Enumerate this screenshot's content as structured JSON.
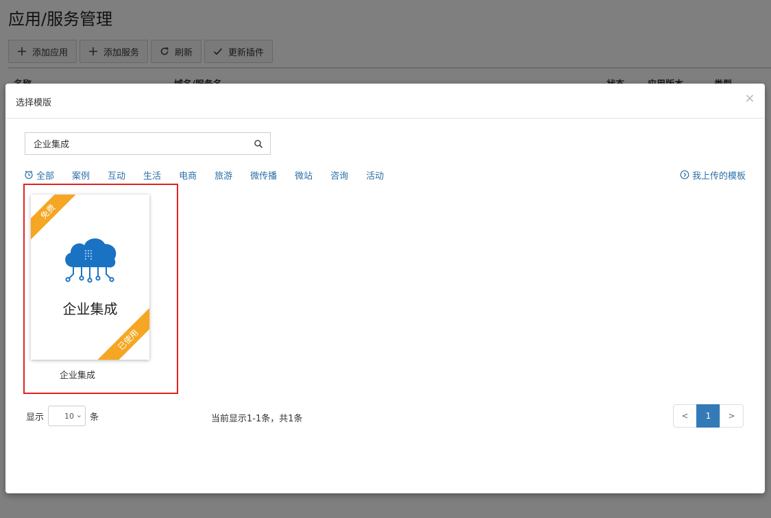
{
  "page": {
    "title": "应用/服务管理",
    "toolbar": [
      {
        "label": "添加应用",
        "icon": "plus-icon"
      },
      {
        "label": "添加服务",
        "icon": "plus-icon"
      },
      {
        "label": "刷新",
        "icon": "refresh-icon"
      },
      {
        "label": "更新插件",
        "icon": "check-icon"
      }
    ],
    "table_headers": [
      "名称",
      "域名/服务名",
      "状态",
      "应用版本",
      "类型"
    ]
  },
  "modal": {
    "title": "选择模版",
    "close_icon": "close-icon",
    "search": {
      "value": "企业集成",
      "placeholder": ""
    },
    "categories": [
      "全部",
      "案例",
      "互动",
      "生活",
      "电商",
      "旅游",
      "微传播",
      "微站",
      "咨询",
      "活动"
    ],
    "my_uploads": "我上传的模板",
    "templates": [
      {
        "name": "企业集成",
        "card_title": "企业集成",
        "ribbon_top": "免费",
        "ribbon_bottom": "已使用",
        "icon": "cloud-icon",
        "selected": true
      }
    ],
    "pager": {
      "show_label": "显示",
      "page_size": "10",
      "unit_label": "条",
      "info": "当前显示1-1条，共1条",
      "prev": "<",
      "current": "1",
      "next": ">"
    }
  },
  "colors": {
    "accent": "#337ab7",
    "link": "#2c6fa8",
    "ribbon": "#f5a623",
    "selection": "#e02020",
    "cloud": "#1a72c2"
  }
}
